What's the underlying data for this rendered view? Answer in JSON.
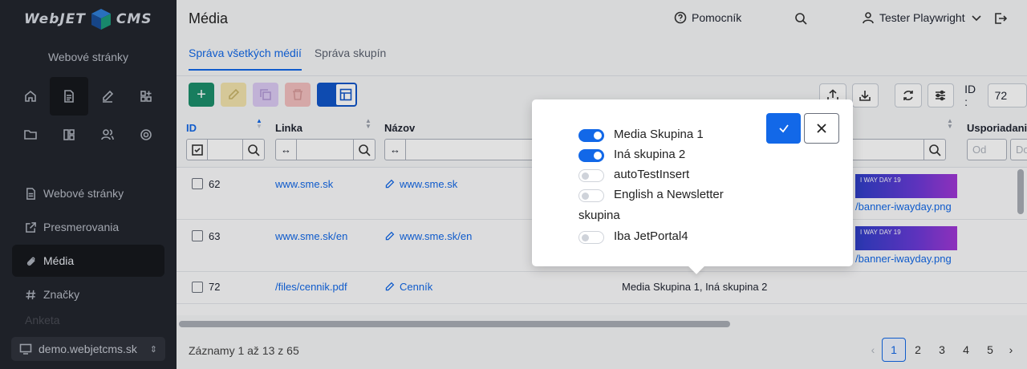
{
  "app": {
    "logo_left": "WebJET",
    "logo_right": "CMS",
    "section": "Webové stránky"
  },
  "sidebar": {
    "icons": [
      "home-icon",
      "document-icon",
      "pencil-icon",
      "apps-icon",
      "folder-icon",
      "columns-icon",
      "users-icon",
      "gear-icon"
    ],
    "items": [
      {
        "label": "Webové stránky",
        "icon": "document-icon"
      },
      {
        "label": "Presmerovania",
        "icon": "external-link-icon"
      },
      {
        "label": "Média",
        "icon": "paperclip-icon",
        "active": true
      },
      {
        "label": "Značky",
        "icon": "hash-icon"
      },
      {
        "label": "Anketa",
        "icon": "poll-icon"
      }
    ],
    "domain": "demo.webjetcms.sk"
  },
  "header": {
    "title": "Média",
    "help": "Pomocník",
    "user": "Tester Playwright"
  },
  "tabs": [
    {
      "label": "Správa všetkých médií",
      "active": true
    },
    {
      "label": "Správa skupín",
      "active": false
    }
  ],
  "toolbar": {
    "add": "+",
    "id_label": "ID :",
    "id_value": "72"
  },
  "table": {
    "columns": [
      "ID",
      "Linka",
      "Názov",
      "Usporiadanie"
    ],
    "filter_placeholder": "Od",
    "filter_placeholder2": "Do",
    "rows": [
      {
        "id": "62",
        "link": "www.sme.sk",
        "name": "www.sme.sk",
        "groups": "",
        "banner_text": "I WAY DAY 19",
        "image": "/banner-iwayday.png"
      },
      {
        "id": "63",
        "link": "www.sme.sk/en",
        "name": "www.sme.sk/en",
        "groups": "",
        "banner_text": "I WAY DAY 19",
        "image": "/banner-iwayday.png"
      },
      {
        "id": "72",
        "link": "/files/cennik.pdf",
        "name": "Cenník",
        "groups": "Media Skupina 1, Iná skupina 2",
        "banner_text": "",
        "image": ""
      }
    ]
  },
  "footer": {
    "records": "Záznamy 1 až 13 z 65",
    "pages": [
      "1",
      "2",
      "3",
      "4",
      "5"
    ],
    "active_page": "1"
  },
  "popover": {
    "options": [
      {
        "label": "Media Skupina 1",
        "on": true
      },
      {
        "label": "Iná skupina 2",
        "on": true
      },
      {
        "label": "autoTestInsert",
        "on": false
      },
      {
        "label": "English a Newsletter",
        "label_cont": "skupina",
        "on": false
      },
      {
        "label": "Iba JetPortal4",
        "on": false
      }
    ]
  },
  "colors": {
    "sidebar_bg": "#23262e",
    "accent": "#1268e8",
    "add_green": "#1c8f6b"
  }
}
